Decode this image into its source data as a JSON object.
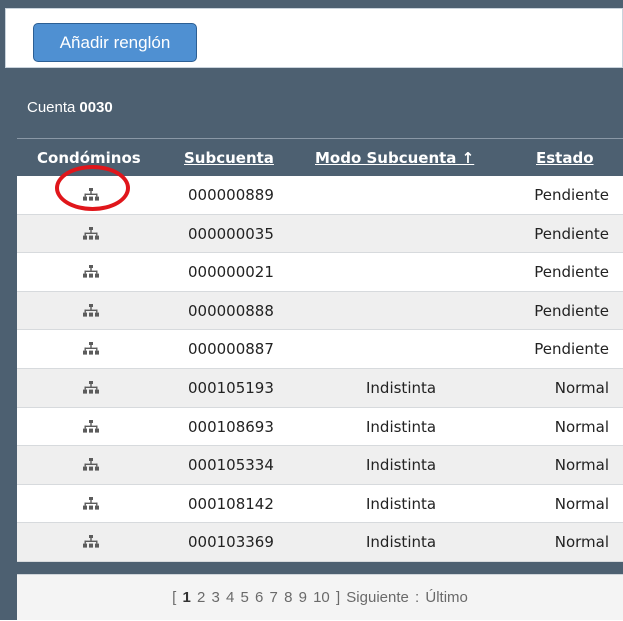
{
  "toolbar": {
    "add_row_label": "Añadir renglón"
  },
  "account": {
    "label": "Cuenta",
    "number": "0030"
  },
  "table": {
    "headers": {
      "condominos": "Condóminos",
      "subcuenta": "Subcuenta",
      "modo": "Modo Subcuenta ↑",
      "estado": "Estado"
    },
    "rows": [
      {
        "subcuenta": "000000889",
        "modo": "",
        "estado": "Pendiente"
      },
      {
        "subcuenta": "000000035",
        "modo": "",
        "estado": "Pendiente"
      },
      {
        "subcuenta": "000000021",
        "modo": "",
        "estado": "Pendiente"
      },
      {
        "subcuenta": "000000888",
        "modo": "",
        "estado": "Pendiente"
      },
      {
        "subcuenta": "000000887",
        "modo": "",
        "estado": "Pendiente"
      },
      {
        "subcuenta": "000105193",
        "modo": "Indistinta",
        "estado": "Normal"
      },
      {
        "subcuenta": "000108693",
        "modo": "Indistinta",
        "estado": "Normal"
      },
      {
        "subcuenta": "000105334",
        "modo": "Indistinta",
        "estado": "Normal"
      },
      {
        "subcuenta": "000108142",
        "modo": "Indistinta",
        "estado": "Normal"
      },
      {
        "subcuenta": "000103369",
        "modo": "Indistinta",
        "estado": "Normal"
      }
    ]
  },
  "pager": {
    "open": "[",
    "current": "1",
    "pages": [
      "2",
      "3",
      "4",
      "5",
      "6",
      "7",
      "8",
      "9",
      "10"
    ],
    "close": "]",
    "next": "Siguiente",
    "sep": ":",
    "last": "Último"
  },
  "colors": {
    "header_bg": "#4d6071",
    "button_bg": "#4f90d2",
    "alt_row": "#efefef",
    "icon": "#5c5c5c",
    "highlight": "#e0161b"
  },
  "icons": {
    "condominos_icon": "sitemap-icon"
  }
}
